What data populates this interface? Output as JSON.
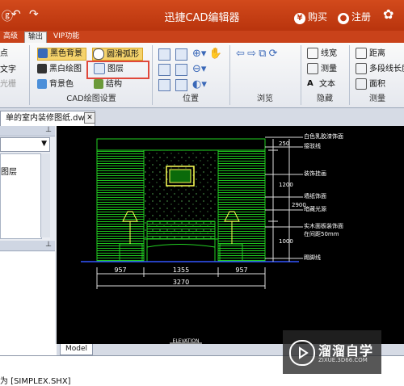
{
  "app": {
    "title": "迅捷CAD编辑器"
  },
  "titlebar": {
    "buy_label": "购买",
    "register_label": "注册",
    "buy_symbol": "¥"
  },
  "menu_tabs": [
    "高级",
    "输出",
    "VIP功能"
  ],
  "ribbon": {
    "draw_settings": {
      "items": [
        "黑色背景",
        "黑白绘图",
        "背景色",
        "圆滑弧形",
        "图层",
        "结构"
      ],
      "group_label": "CAD绘图设置",
      "highlighted_item": "图层"
    },
    "left_partial_items": [
      "点",
      "文字",
      "光栅"
    ],
    "position": {
      "group_label": "位置"
    },
    "browse": {
      "group_label": "浏览"
    },
    "hide": {
      "items": [
        "线宽",
        "测量",
        "文本"
      ],
      "group_label": "隐藏"
    },
    "measure": {
      "items": [
        "距离",
        "多段线长度",
        "面积"
      ],
      "group_label": "测量"
    }
  },
  "file_tab": {
    "label": "单的室内装修图纸.dwg"
  },
  "left_panel": {
    "list_items": [
      "图层",
      "",
      ""
    ]
  },
  "drawing": {
    "dimensions": {
      "left": "957",
      "center": "1355",
      "right": "957",
      "total": "3270",
      "h1": "250",
      "h2": "1200",
      "h3": "1000",
      "h_total": "2900"
    },
    "annotations": [
      "白色乳胶漆饰面",
      "接驳线",
      "装饰挂画",
      "墙纸饰面",
      "暗藏光源",
      "实木面板装饰面",
      "在间距50mm",
      "踢脚线"
    ],
    "elevation_label": "ELEVATION"
  },
  "model_tab": {
    "label": "Model"
  },
  "command_line": {
    "text": "为 [SIMPLEX.SHX]"
  },
  "watermark": {
    "title": "溜溜自学",
    "url": "ZIXUE.3D66.COM"
  }
}
